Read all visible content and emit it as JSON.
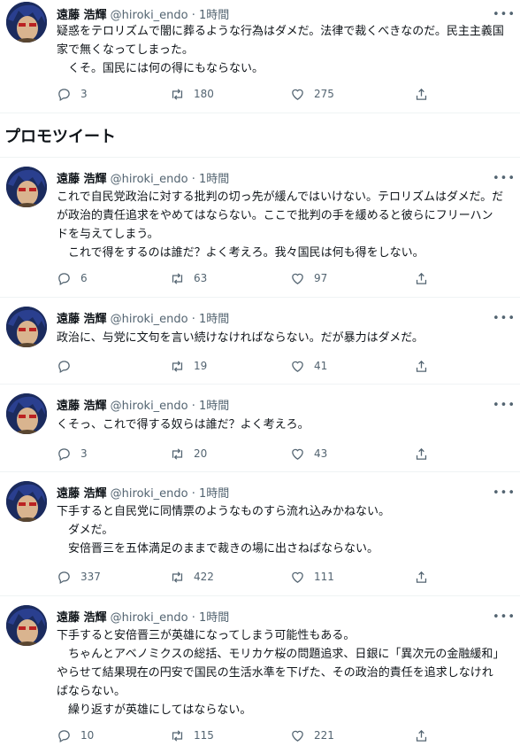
{
  "promo_heading": "プロモツイート",
  "tweets": [
    {
      "name": "遠藤 浩輝",
      "meta": "@hiroki_endo · 1時間",
      "text": "疑惑をテロリズムで闇に葬るような行為はダメだ。法律で裁くべきなのだ。民主主義国家で無くなってしまった。\n　くそ。国民には何の得にもならない。",
      "replies": "3",
      "retweets": "180",
      "likes": "275"
    },
    {
      "name": "遠藤 浩輝",
      "meta": "@hiroki_endo · 1時間",
      "text": "これで自民党政治に対する批判の切っ先が緩んではいけない。テロリズムはダメだ。だが政治的責任追求をやめてはならない。ここで批判の手を緩めると彼らにフリーハンドを与えてしまう。\n　これで得をするのは誰だ？よく考えろ。我々国民は何も得をしない。",
      "replies": "6",
      "retweets": "63",
      "likes": "97"
    },
    {
      "name": "遠藤 浩輝",
      "meta": "@hiroki_endo · 1時間",
      "text": "政治に、与党に文句を言い続けなければならない。だが暴力はダメだ。",
      "replies": "",
      "retweets": "19",
      "likes": "41"
    },
    {
      "name": "遠藤 浩輝",
      "meta": "@hiroki_endo · 1時間",
      "text": "くそっ、これで得する奴らは誰だ？よく考えろ。",
      "replies": "3",
      "retweets": "20",
      "likes": "43"
    },
    {
      "name": "遠藤 浩輝",
      "meta": "@hiroki_endo · 1時間",
      "text": "下手すると自民党に同情票のようなものすら流れ込みかねない。\n　ダメだ。\n　安倍晋三を五体満足のままで裁きの場に出さねばならない。",
      "replies": "337",
      "retweets": "422",
      "likes": "111"
    },
    {
      "name": "遠藤 浩輝",
      "meta": "@hiroki_endo · 1時間",
      "text": "下手すると安倍晋三が英雄になってしまう可能性もある。\n　ちゃんとアベノミクスの総括、モリカケ桜の問題追求、日銀に「異次元の金融緩和」やらせて結果現在の円安で国民の生活水準を下げた、その政治的責任を追求しなければならない。\n　繰り返すが英雄にしてはならない。",
      "replies": "10",
      "retweets": "115",
      "likes": "221"
    }
  ]
}
